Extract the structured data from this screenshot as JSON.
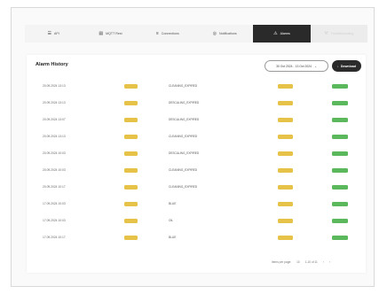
{
  "tabs": [
    {
      "label": "API",
      "icon": "link-icon",
      "glyph": "☰",
      "state": "normal"
    },
    {
      "label": "MQTT Rest",
      "icon": "document-icon",
      "glyph": "▤",
      "state": "normal"
    },
    {
      "label": "Connections",
      "icon": "sliders-icon",
      "glyph": "≡",
      "state": "normal"
    },
    {
      "label": "Notifications",
      "icon": "bell-icon",
      "glyph": "◎",
      "state": "normal"
    },
    {
      "label": "Alarms",
      "icon": "warning-icon",
      "glyph": "⚠",
      "state": "active"
    },
    {
      "label": "Troubleshooting",
      "icon": "tool-icon",
      "glyph": "⚒",
      "state": "disabled"
    }
  ],
  "card": {
    "title": "Alarm History",
    "date_range": "30 Oct 2024 - 13 Oct 2024",
    "date_range_chevron": "⌄",
    "download_label": "Download",
    "download_glyph": "↓"
  },
  "alarms": [
    {
      "date": "20.09.2024 13:13",
      "code": "CLEANING_EXPIRED"
    },
    {
      "date": "20.09.2024 13:13",
      "code": "DESCALING_EXPIRED"
    },
    {
      "date": "20.09.2024 13:07",
      "code": "DESCALING_EXPIRED"
    },
    {
      "date": "20.09.2024 13:13",
      "code": "CLEANING_EXPIRED"
    },
    {
      "date": "20.09.2024 10:03",
      "code": "DESCALING_EXPIRED"
    },
    {
      "date": "20.09.2024 10:03",
      "code": "CLEANING_EXPIRED"
    },
    {
      "date": "20.09.2024 10:17",
      "code": "CLEANING_EXPIRED"
    },
    {
      "date": "17.09.2024 10:03",
      "code": "BLUE"
    },
    {
      "date": "17.09.2024 10:03",
      "code": "OIL"
    },
    {
      "date": "17.09.2024 10:17",
      "code": "BLUE"
    }
  ],
  "footer": {
    "rows_per_page_label": "Items per page:",
    "rows_per_page_value": "10",
    "range_text": "1-10 of 11",
    "prev_glyph": "‹",
    "next_glyph": "›"
  },
  "colors": {
    "yellow": "#e6c348",
    "green": "#5cb85c",
    "dark": "#2a2a2a"
  }
}
